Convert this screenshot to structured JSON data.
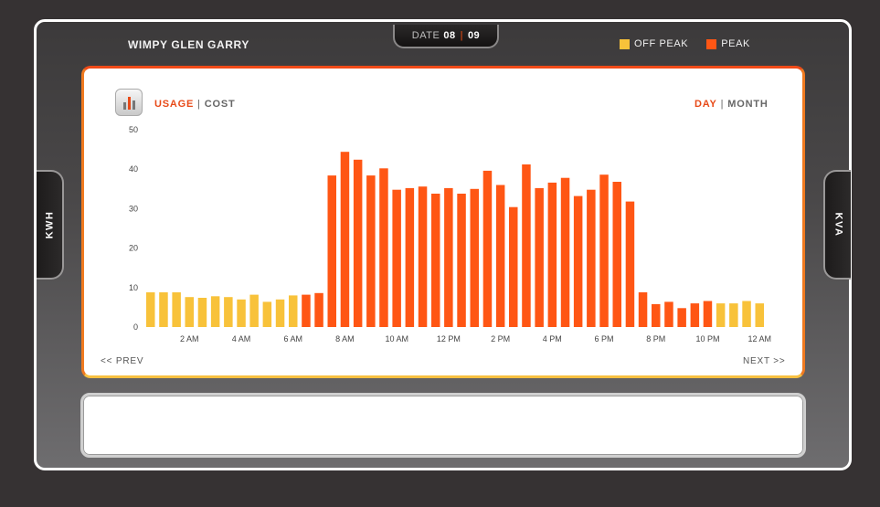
{
  "site": {
    "title": "WIMPY GLEN GARRY"
  },
  "date": {
    "label": "DATE",
    "month": "08",
    "day": "09"
  },
  "legend": [
    {
      "label": "OFF PEAK",
      "color": "#f8c23a"
    },
    {
      "label": "PEAK",
      "color": "#ff5614"
    }
  ],
  "side_tabs": {
    "left": "KWH",
    "right": "KVA"
  },
  "view_toggle": {
    "usage": "USAGE",
    "cost": "COST",
    "separator": "|"
  },
  "period_toggle": {
    "day": "DAY",
    "month": "MONTH",
    "separator": "|"
  },
  "nav": {
    "prev": "<< PREV",
    "next": "NEXT >>"
  },
  "icons": {
    "chart": "bar-chart-icon"
  },
  "chart_data": {
    "type": "bar",
    "ylim": [
      0,
      50
    ],
    "y_ticks": [
      0,
      10,
      20,
      30,
      40,
      50
    ],
    "x_tick_labels": [
      "2 AM",
      "4 AM",
      "6 AM",
      "8 AM",
      "10 AM",
      "12 PM",
      "2 PM",
      "4 PM",
      "6 PM",
      "8 PM",
      "10 PM",
      "12 AM"
    ],
    "x_tick_positions": [
      3,
      7,
      11,
      15,
      19,
      23,
      27,
      31,
      35,
      39,
      43,
      47
    ],
    "values": [
      8.8,
      8.8,
      8.8,
      7.6,
      7.4,
      7.8,
      7.6,
      7.0,
      8.2,
      6.4,
      7.0,
      8.0,
      8.2,
      8.6,
      38.4,
      44.4,
      42.4,
      38.4,
      40.2,
      34.8,
      35.2,
      35.6,
      33.8,
      35.2,
      33.8,
      35.0,
      39.6,
      36.0,
      30.4,
      41.2,
      35.2,
      36.6,
      37.8,
      33.2,
      34.8,
      38.6,
      36.8,
      31.8,
      8.8,
      5.8,
      6.4,
      4.8,
      6.0,
      6.6,
      6.0,
      6.0,
      6.6,
      6.0
    ],
    "categories_peak": [
      "off",
      "off",
      "off",
      "off",
      "off",
      "off",
      "off",
      "off",
      "off",
      "off",
      "off",
      "off",
      "peak",
      "peak",
      "peak",
      "peak",
      "peak",
      "peak",
      "peak",
      "peak",
      "peak",
      "peak",
      "peak",
      "peak",
      "peak",
      "peak",
      "peak",
      "peak",
      "peak",
      "peak",
      "peak",
      "peak",
      "peak",
      "peak",
      "peak",
      "peak",
      "peak",
      "peak",
      "peak",
      "peak",
      "peak",
      "peak",
      "peak",
      "peak",
      "off",
      "off",
      "off",
      "off"
    ]
  }
}
